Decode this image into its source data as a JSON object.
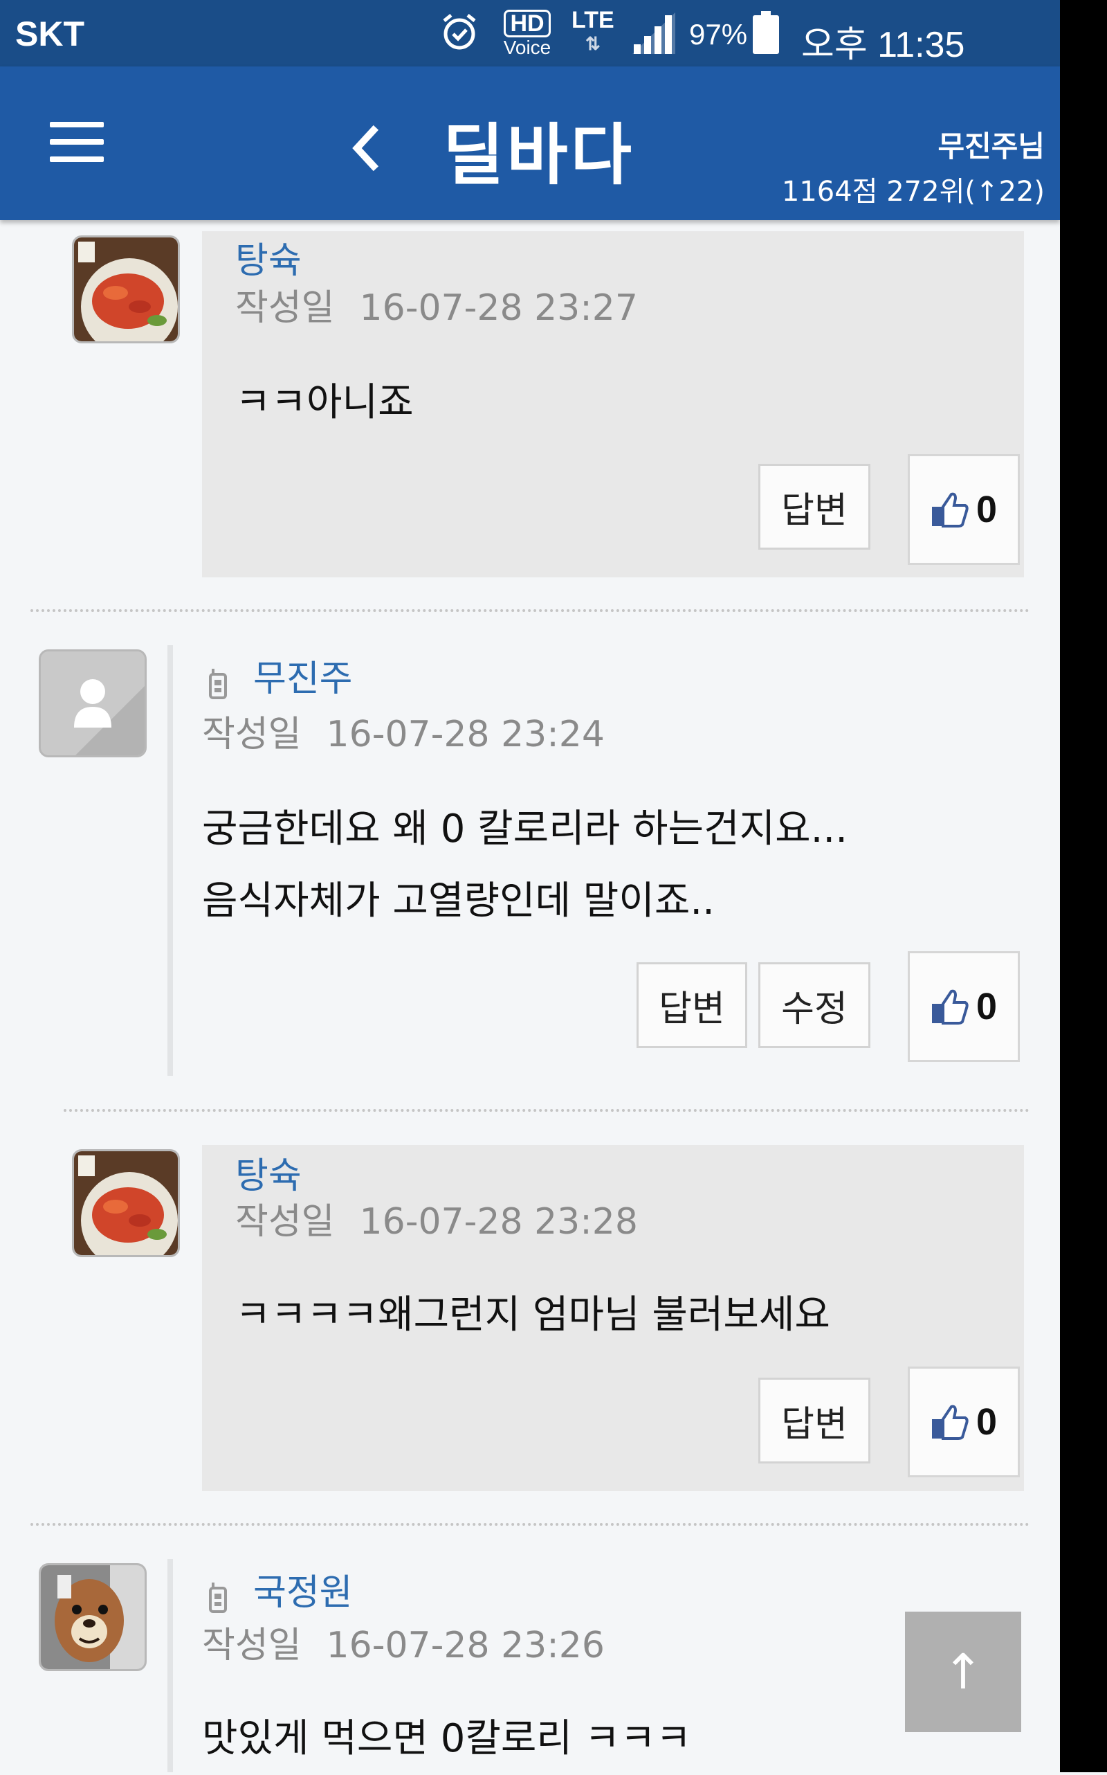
{
  "status_bar": {
    "carrier": "SKT",
    "hd_label": "HD",
    "voice_label": "Voice",
    "network": "LTE",
    "battery_percent": "97%",
    "time": "오후 11:35",
    "icons": [
      "alarm-icon",
      "hd-voice-icon",
      "lte-icon",
      "signal-icon",
      "battery-icon"
    ]
  },
  "header": {
    "title": "딜바다",
    "user_name": "무진주님",
    "user_points": "1164점 272위(↑22)",
    "accent_color": "#1f5aa5"
  },
  "comments": [
    {
      "author": "탕슉",
      "date_label": "작성일",
      "date": "16-07-28 23:27",
      "body": [
        "ㅋㅋ아니죠"
      ],
      "reply_label": "답변",
      "likes": "0",
      "is_reply": true
    },
    {
      "author": "무진주",
      "date_label": "작성일",
      "date": "16-07-28 23:24",
      "body": [
        "궁금한데요 왜 0 칼로리라 하는건지요...",
        "음식자체가 고열량인데 말이죠.."
      ],
      "reply_label": "답변",
      "edit_label": "수정",
      "likes": "0",
      "is_reply": false,
      "mobile": true
    },
    {
      "author": "탕슉",
      "date_label": "작성일",
      "date": "16-07-28 23:28",
      "body": [
        "ㅋㅋㅋㅋ왜그런지 엄마님 불러보세요"
      ],
      "reply_label": "답변",
      "likes": "0",
      "is_reply": true
    },
    {
      "author": "국정원",
      "date_label": "작성일",
      "date": "16-07-28 23:26",
      "body": [
        "맛있게 먹으면 0칼로리 ㅋㅋㅋ"
      ],
      "is_reply": false,
      "mobile": true
    }
  ],
  "scroll_top_label": "↑"
}
